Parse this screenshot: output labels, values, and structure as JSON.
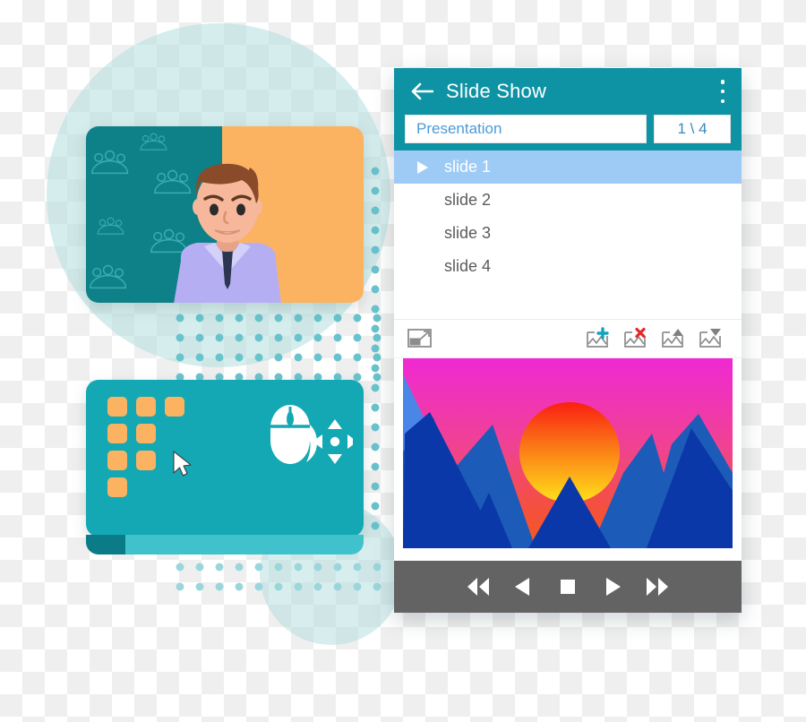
{
  "app": {
    "title": "Slide Show",
    "back_icon": "back-arrow-icon",
    "menu_icon": "kebab-menu-icon",
    "header_color": "#0e93a5",
    "presentation_name": "Presentation",
    "presentation_name_placeholder": "Presentation",
    "page_indicator": "1 \\ 4"
  },
  "slides": [
    {
      "label": "slide 1",
      "selected": true,
      "play_icon": "play-triangle-icon"
    },
    {
      "label": "slide 2",
      "selected": false,
      "play_icon": ""
    },
    {
      "label": "slide 3",
      "selected": false,
      "play_icon": ""
    },
    {
      "label": "slide 4",
      "selected": false,
      "play_icon": ""
    }
  ],
  "toolbar": {
    "resize_icon": "resize-image-icon",
    "add_icon": "add-image-icon",
    "delete_icon": "delete-image-icon",
    "move_up_icon": "move-image-up-icon",
    "move_down_icon": "move-image-down-icon",
    "add_accent": "#12a4bb",
    "delete_accent": "#e8262c",
    "move_accent": "#808080"
  },
  "preview": {
    "name": "sunset-mountains-slide",
    "sky_top": "#ef29d4",
    "sky_bottom": "#f4581e",
    "sun_top": "#f91f12",
    "sun_bottom": "#ffe11a",
    "mountain_back": "#1c5bb8",
    "mountain_front": "#0b38a8",
    "mountain_far": "#4a86e8"
  },
  "playback": [
    {
      "name": "rewind-button",
      "icon": "rewind-icon"
    },
    {
      "name": "previous-button",
      "icon": "previous-icon"
    },
    {
      "name": "stop-button",
      "icon": "stop-icon"
    },
    {
      "name": "play-button",
      "icon": "play-icon"
    },
    {
      "name": "fast-forward-button",
      "icon": "fast-forward-icon"
    }
  ],
  "illustration": {
    "presenter_card": {
      "name": "presenter-video-card",
      "left_color": "#0e8088",
      "right_color": "#fbb361",
      "pattern_icon": "group-people-pattern-icon",
      "shirt_color": "#b6aef3",
      "tie_color": "#2c3650",
      "hair_color": "#8a4b2a",
      "skin_color": "#f6b79b"
    },
    "mouse_card": {
      "name": "mouse-control-card",
      "card_color": "#13a8b4",
      "base_color": "#3fc2cc",
      "base_dark_color": "#0b7c87",
      "square_color": "#fbb361",
      "cursor_icon": "cursor-arrow-icon",
      "mouse_icon": "mouse-move-icon",
      "squares_rows": [
        3,
        2,
        2,
        1
      ]
    },
    "background": {
      "circle_color": "#b2dede",
      "dot_color": "#69c3cd"
    }
  }
}
